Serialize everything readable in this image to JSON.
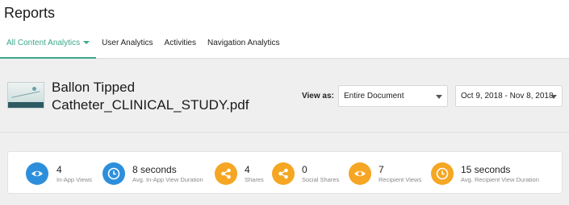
{
  "header": {
    "title": "Reports",
    "tabs": [
      {
        "label": "All Content Analytics",
        "active": true
      },
      {
        "label": "User Analytics"
      },
      {
        "label": "Activities"
      },
      {
        "label": "Navigation Analytics"
      }
    ]
  },
  "document": {
    "title_line1": "Ballon Tipped",
    "title_line2": "Catheter_CLINICAL_STUDY.pdf",
    "view_as_label": "View as:",
    "view_as_value": "Entire Document",
    "date_range": "Oct 9, 2018 - Nov 8, 2018"
  },
  "stats": [
    {
      "value": "4",
      "label": "In-App Views",
      "icon": "eye-icon",
      "color": "#2d8fdc"
    },
    {
      "value": "8 seconds",
      "label": "Avg. In-App View Duration",
      "icon": "clock-icon",
      "color": "#2d8fdc"
    },
    {
      "value": "4",
      "label": "Shares",
      "icon": "share-icon",
      "color": "#f5a623"
    },
    {
      "value": "0",
      "label": "Social Shares",
      "icon": "share-icon",
      "color": "#f5a623"
    },
    {
      "value": "7",
      "label": "Recipient Views",
      "icon": "eye-icon",
      "color": "#f5a623"
    },
    {
      "value": "15 seconds",
      "label": "Avg. Recipient View Duration",
      "icon": "clock-icon",
      "color": "#f5a623"
    }
  ],
  "colors": {
    "accent": "#3ba88a",
    "blue": "#2d8fdc",
    "orange": "#f5a623"
  }
}
